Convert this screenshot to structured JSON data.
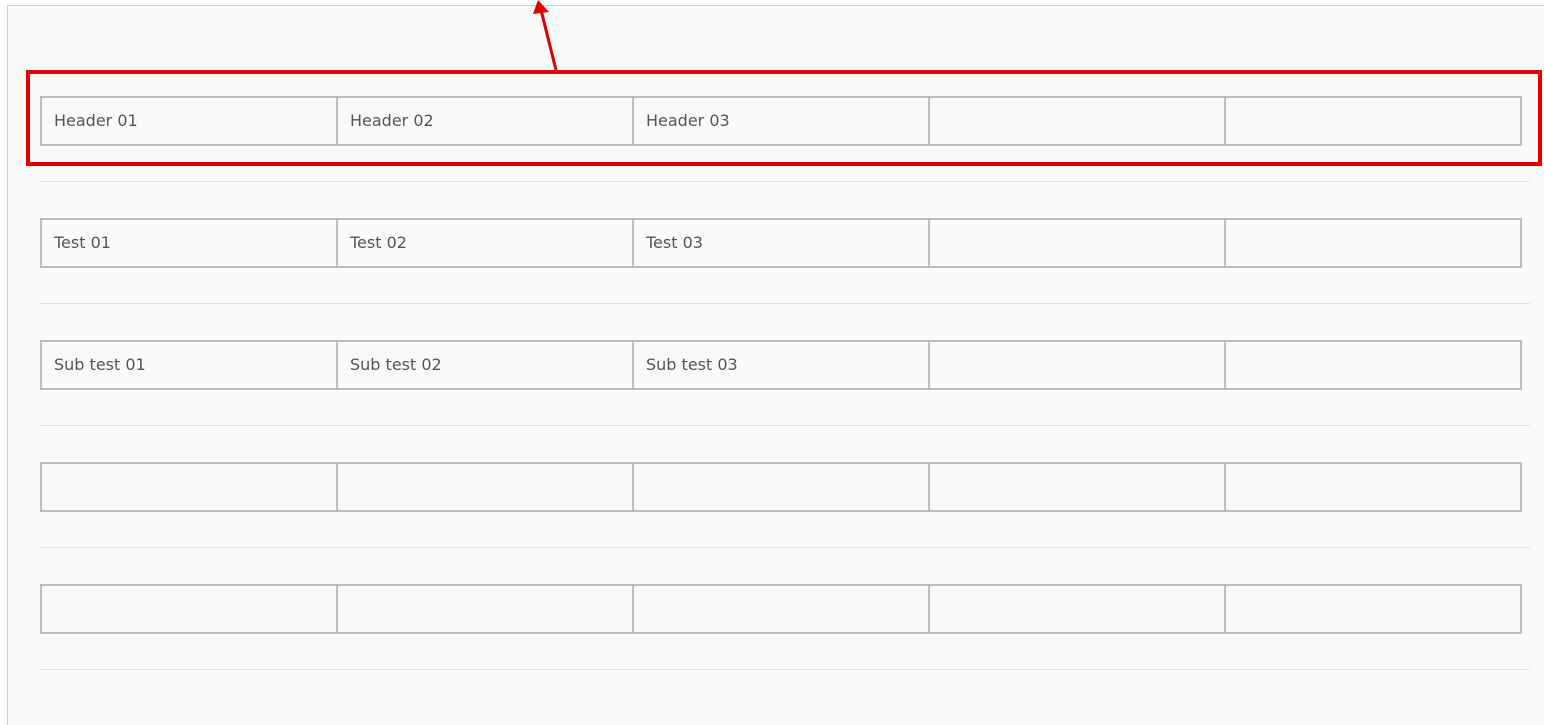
{
  "table": {
    "rows": [
      [
        "Header 01",
        "Header 02",
        "Header 03",
        "",
        ""
      ],
      [
        "Test 01",
        "Test 02",
        "Test 03",
        "",
        ""
      ],
      [
        "Sub test 01",
        "Sub test 02",
        "Sub test 03",
        "",
        ""
      ],
      [
        "",
        "",
        "",
        "",
        ""
      ],
      [
        "",
        "",
        "",
        "",
        ""
      ]
    ]
  },
  "annotation": {
    "color": "#e00000",
    "target": "header-row"
  }
}
